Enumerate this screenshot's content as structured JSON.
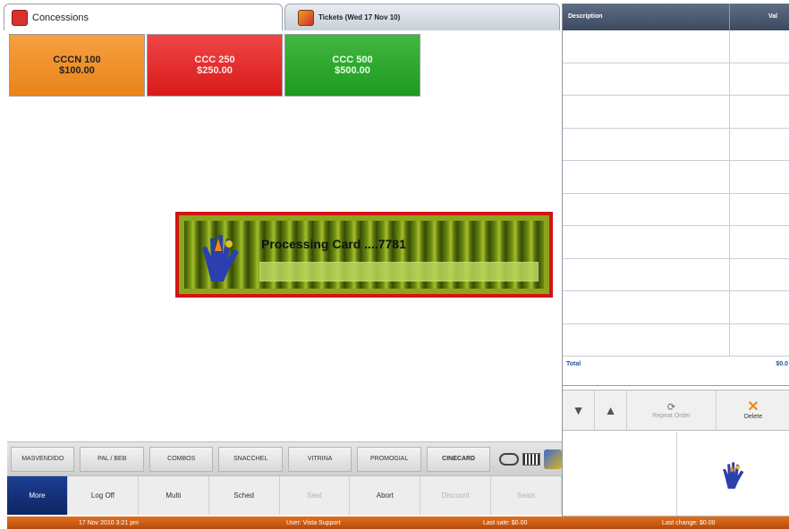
{
  "tabs": [
    {
      "label": "Concessions"
    },
    {
      "label": "Tickets (Wed 17 Nov 10)"
    }
  ],
  "products": [
    {
      "name": "CCCN 100",
      "price": "$100.00",
      "color": "#f0901c"
    },
    {
      "name": "CCC 250",
      "price": "$250.00",
      "color": "#e02020"
    },
    {
      "name": "CCC 500",
      "price": "$500.00",
      "color": "#2aa62a"
    }
  ],
  "processing": {
    "message": "Processing Card ....7781",
    "progress": 1.0
  },
  "categories": [
    {
      "label": "MASVENDIDO"
    },
    {
      "label": "PAL / BEB"
    },
    {
      "label": "COMBOS"
    },
    {
      "label": "SNACCHEL"
    },
    {
      "label": "VITRINA"
    },
    {
      "label": "PROMOGIAL"
    },
    {
      "label": "CINECARD"
    }
  ],
  "functions": [
    {
      "label": "More"
    },
    {
      "label": "Log Off"
    },
    {
      "label": "Multi"
    },
    {
      "label": "Sched"
    },
    {
      "label": "Seat"
    },
    {
      "label": "Abort"
    },
    {
      "label": "Discount"
    },
    {
      "label": "Seats"
    }
  ],
  "order": {
    "col_description": "Description",
    "col_value": "Val",
    "total_label": "Total",
    "total_value": "$0.0"
  },
  "controls": {
    "down": "▼",
    "up": "▲",
    "repeat_label": "Repeat Order",
    "delete_label": "Delete"
  },
  "status": {
    "datetime": "17 Nov 2010 3:21 pm",
    "user": "User: Vista Support",
    "last_sale": "Last sale: $0.00",
    "last_change": "Last change: $0.00"
  },
  "colors": {
    "accent_blue": "#1c3e94",
    "status_orange": "#d0601a",
    "dialog_border": "#d01515"
  }
}
